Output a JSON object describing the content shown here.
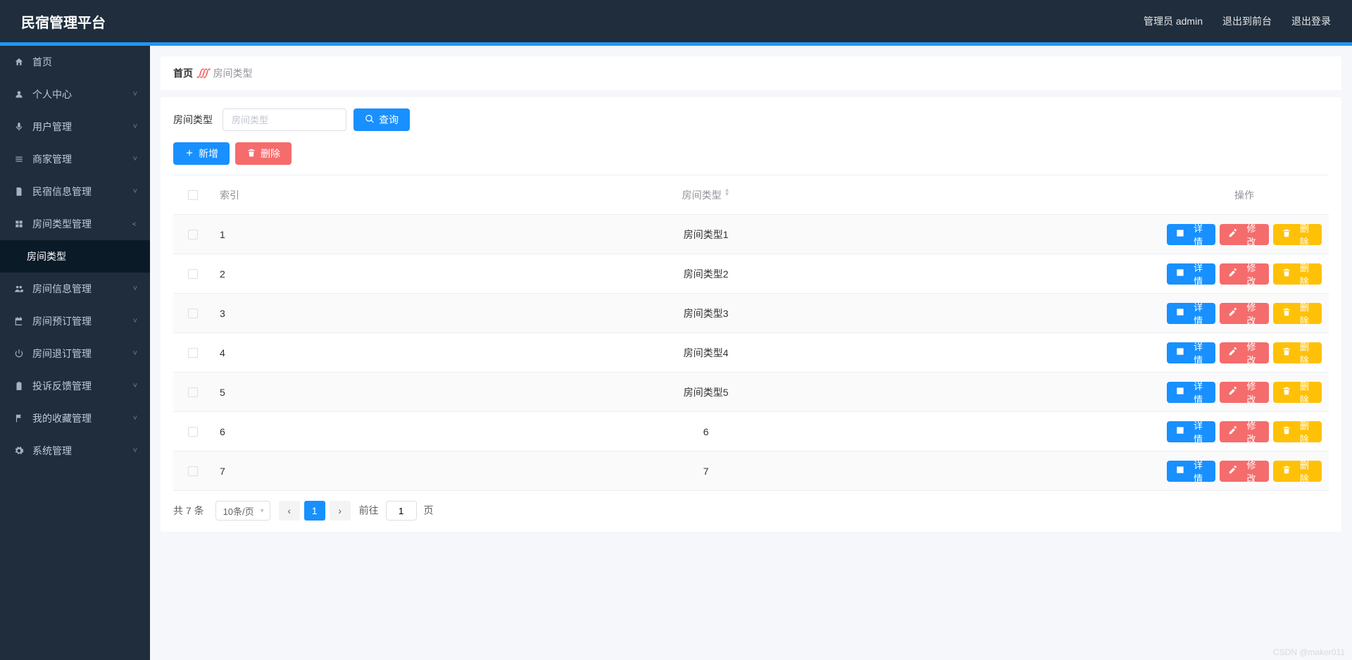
{
  "brand": "民宿管理平台",
  "nav": {
    "user_label": "管理员 admin",
    "to_front": "退出到前台",
    "logout": "退出登录"
  },
  "sidebar": {
    "items": [
      {
        "icon": "home-icon",
        "label": "首页",
        "expandable": false
      },
      {
        "icon": "user-icon",
        "label": "个人中心",
        "expandable": true
      },
      {
        "icon": "mic-icon",
        "label": "用户管理",
        "expandable": true
      },
      {
        "icon": "list-icon",
        "label": "商家管理",
        "expandable": true
      },
      {
        "icon": "doc-icon",
        "label": "民宿信息管理",
        "expandable": true
      },
      {
        "icon": "grid-icon",
        "label": "房间类型管理",
        "expandable": true,
        "expanded": true,
        "children": [
          {
            "label": "房间类型",
            "active": true
          }
        ]
      },
      {
        "icon": "users-icon",
        "label": "房间信息管理",
        "expandable": true
      },
      {
        "icon": "calendar-icon",
        "label": "房间预订管理",
        "expandable": true
      },
      {
        "icon": "power-icon",
        "label": "房间退订管理",
        "expandable": true
      },
      {
        "icon": "clipboard-icon",
        "label": "投诉反馈管理",
        "expandable": true
      },
      {
        "icon": "flag-icon",
        "label": "我的收藏管理",
        "expandable": true
      },
      {
        "icon": "gear-icon",
        "label": "系统管理",
        "expandable": true
      }
    ]
  },
  "breadcrumb": {
    "home": "首页",
    "current": "房间类型"
  },
  "search": {
    "label": "房间类型",
    "placeholder": "房间类型",
    "button": "查询"
  },
  "toolbar": {
    "add": "新增",
    "delete": "删除"
  },
  "table": {
    "cols": {
      "index": "索引",
      "type": "房间类型",
      "ops": "操作"
    },
    "ops": {
      "detail": "详情",
      "edit": "修改",
      "del": "删除"
    },
    "rows": [
      {
        "idx": "1",
        "type": "房间类型1"
      },
      {
        "idx": "2",
        "type": "房间类型2"
      },
      {
        "idx": "3",
        "type": "房间类型3"
      },
      {
        "idx": "4",
        "type": "房间类型4"
      },
      {
        "idx": "5",
        "type": "房间类型5"
      },
      {
        "idx": "6",
        "type": "6"
      },
      {
        "idx": "7",
        "type": "7"
      }
    ]
  },
  "pagination": {
    "total_text": "共 7 条",
    "page_size": "10条/页",
    "current_page": "1",
    "goto_prefix": "前往",
    "goto_suffix": "页",
    "goto_value": "1"
  },
  "watermark": "CSDN @maker011"
}
